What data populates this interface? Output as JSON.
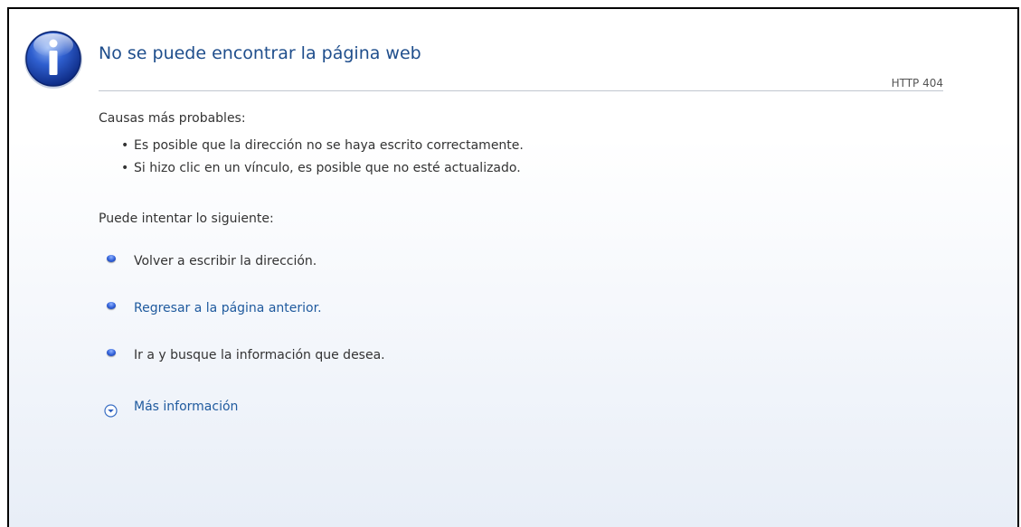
{
  "page": {
    "title": "No se puede encontrar la página web",
    "status_code": "HTTP 404"
  },
  "causes": {
    "heading": "Causas más probables:",
    "items": [
      "Es posible que la dirección no se haya escrito correctamente.",
      "Si hizo clic en un vínculo, es posible que no esté actualizado."
    ]
  },
  "suggestions": {
    "heading": "Puede intentar lo siguiente:",
    "retype": "Volver a escribir la dirección.",
    "back_link": "Regresar a la página anterior.",
    "goto": "Ir a  y busque la información que desea."
  },
  "more_info": {
    "label": "Más información",
    "icon": "chevron-down-circle-icon"
  },
  "icons": {
    "main": "info-icon",
    "bullet": "blue-bullet-icon"
  },
  "colors": {
    "title": "#1f4e8c",
    "link": "#1f5a9e",
    "text": "#333333",
    "icon_blue": "#2b58c4"
  }
}
